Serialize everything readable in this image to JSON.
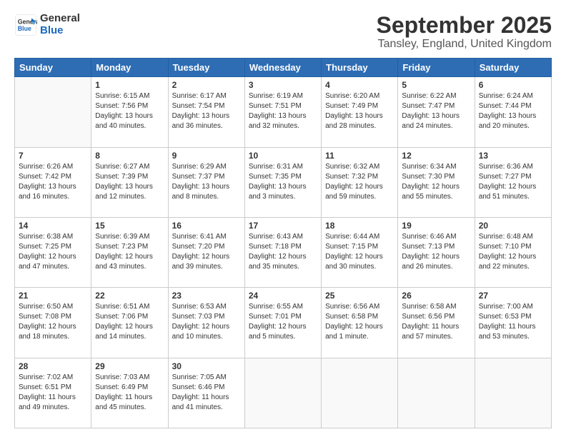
{
  "logo": {
    "line1": "General",
    "line2": "Blue"
  },
  "title": "September 2025",
  "location": "Tansley, England, United Kingdom",
  "weekdays": [
    "Sunday",
    "Monday",
    "Tuesday",
    "Wednesday",
    "Thursday",
    "Friday",
    "Saturday"
  ],
  "weeks": [
    [
      {
        "day": "",
        "sunrise": "",
        "sunset": "",
        "daylight": ""
      },
      {
        "day": "1",
        "sunrise": "Sunrise: 6:15 AM",
        "sunset": "Sunset: 7:56 PM",
        "daylight": "Daylight: 13 hours and 40 minutes."
      },
      {
        "day": "2",
        "sunrise": "Sunrise: 6:17 AM",
        "sunset": "Sunset: 7:54 PM",
        "daylight": "Daylight: 13 hours and 36 minutes."
      },
      {
        "day": "3",
        "sunrise": "Sunrise: 6:19 AM",
        "sunset": "Sunset: 7:51 PM",
        "daylight": "Daylight: 13 hours and 32 minutes."
      },
      {
        "day": "4",
        "sunrise": "Sunrise: 6:20 AM",
        "sunset": "Sunset: 7:49 PM",
        "daylight": "Daylight: 13 hours and 28 minutes."
      },
      {
        "day": "5",
        "sunrise": "Sunrise: 6:22 AM",
        "sunset": "Sunset: 7:47 PM",
        "daylight": "Daylight: 13 hours and 24 minutes."
      },
      {
        "day": "6",
        "sunrise": "Sunrise: 6:24 AM",
        "sunset": "Sunset: 7:44 PM",
        "daylight": "Daylight: 13 hours and 20 minutes."
      }
    ],
    [
      {
        "day": "7",
        "sunrise": "Sunrise: 6:26 AM",
        "sunset": "Sunset: 7:42 PM",
        "daylight": "Daylight: 13 hours and 16 minutes."
      },
      {
        "day": "8",
        "sunrise": "Sunrise: 6:27 AM",
        "sunset": "Sunset: 7:39 PM",
        "daylight": "Daylight: 13 hours and 12 minutes."
      },
      {
        "day": "9",
        "sunrise": "Sunrise: 6:29 AM",
        "sunset": "Sunset: 7:37 PM",
        "daylight": "Daylight: 13 hours and 8 minutes."
      },
      {
        "day": "10",
        "sunrise": "Sunrise: 6:31 AM",
        "sunset": "Sunset: 7:35 PM",
        "daylight": "Daylight: 13 hours and 3 minutes."
      },
      {
        "day": "11",
        "sunrise": "Sunrise: 6:32 AM",
        "sunset": "Sunset: 7:32 PM",
        "daylight": "Daylight: 12 hours and 59 minutes."
      },
      {
        "day": "12",
        "sunrise": "Sunrise: 6:34 AM",
        "sunset": "Sunset: 7:30 PM",
        "daylight": "Daylight: 12 hours and 55 minutes."
      },
      {
        "day": "13",
        "sunrise": "Sunrise: 6:36 AM",
        "sunset": "Sunset: 7:27 PM",
        "daylight": "Daylight: 12 hours and 51 minutes."
      }
    ],
    [
      {
        "day": "14",
        "sunrise": "Sunrise: 6:38 AM",
        "sunset": "Sunset: 7:25 PM",
        "daylight": "Daylight: 12 hours and 47 minutes."
      },
      {
        "day": "15",
        "sunrise": "Sunrise: 6:39 AM",
        "sunset": "Sunset: 7:23 PM",
        "daylight": "Daylight: 12 hours and 43 minutes."
      },
      {
        "day": "16",
        "sunrise": "Sunrise: 6:41 AM",
        "sunset": "Sunset: 7:20 PM",
        "daylight": "Daylight: 12 hours and 39 minutes."
      },
      {
        "day": "17",
        "sunrise": "Sunrise: 6:43 AM",
        "sunset": "Sunset: 7:18 PM",
        "daylight": "Daylight: 12 hours and 35 minutes."
      },
      {
        "day": "18",
        "sunrise": "Sunrise: 6:44 AM",
        "sunset": "Sunset: 7:15 PM",
        "daylight": "Daylight: 12 hours and 30 minutes."
      },
      {
        "day": "19",
        "sunrise": "Sunrise: 6:46 AM",
        "sunset": "Sunset: 7:13 PM",
        "daylight": "Daylight: 12 hours and 26 minutes."
      },
      {
        "day": "20",
        "sunrise": "Sunrise: 6:48 AM",
        "sunset": "Sunset: 7:10 PM",
        "daylight": "Daylight: 12 hours and 22 minutes."
      }
    ],
    [
      {
        "day": "21",
        "sunrise": "Sunrise: 6:50 AM",
        "sunset": "Sunset: 7:08 PM",
        "daylight": "Daylight: 12 hours and 18 minutes."
      },
      {
        "day": "22",
        "sunrise": "Sunrise: 6:51 AM",
        "sunset": "Sunset: 7:06 PM",
        "daylight": "Daylight: 12 hours and 14 minutes."
      },
      {
        "day": "23",
        "sunrise": "Sunrise: 6:53 AM",
        "sunset": "Sunset: 7:03 PM",
        "daylight": "Daylight: 12 hours and 10 minutes."
      },
      {
        "day": "24",
        "sunrise": "Sunrise: 6:55 AM",
        "sunset": "Sunset: 7:01 PM",
        "daylight": "Daylight: 12 hours and 5 minutes."
      },
      {
        "day": "25",
        "sunrise": "Sunrise: 6:56 AM",
        "sunset": "Sunset: 6:58 PM",
        "daylight": "Daylight: 12 hours and 1 minute."
      },
      {
        "day": "26",
        "sunrise": "Sunrise: 6:58 AM",
        "sunset": "Sunset: 6:56 PM",
        "daylight": "Daylight: 11 hours and 57 minutes."
      },
      {
        "day": "27",
        "sunrise": "Sunrise: 7:00 AM",
        "sunset": "Sunset: 6:53 PM",
        "daylight": "Daylight: 11 hours and 53 minutes."
      }
    ],
    [
      {
        "day": "28",
        "sunrise": "Sunrise: 7:02 AM",
        "sunset": "Sunset: 6:51 PM",
        "daylight": "Daylight: 11 hours and 49 minutes."
      },
      {
        "day": "29",
        "sunrise": "Sunrise: 7:03 AM",
        "sunset": "Sunset: 6:49 PM",
        "daylight": "Daylight: 11 hours and 45 minutes."
      },
      {
        "day": "30",
        "sunrise": "Sunrise: 7:05 AM",
        "sunset": "Sunset: 6:46 PM",
        "daylight": "Daylight: 11 hours and 41 minutes."
      },
      {
        "day": "",
        "sunrise": "",
        "sunset": "",
        "daylight": ""
      },
      {
        "day": "",
        "sunrise": "",
        "sunset": "",
        "daylight": ""
      },
      {
        "day": "",
        "sunrise": "",
        "sunset": "",
        "daylight": ""
      },
      {
        "day": "",
        "sunrise": "",
        "sunset": "",
        "daylight": ""
      }
    ]
  ]
}
